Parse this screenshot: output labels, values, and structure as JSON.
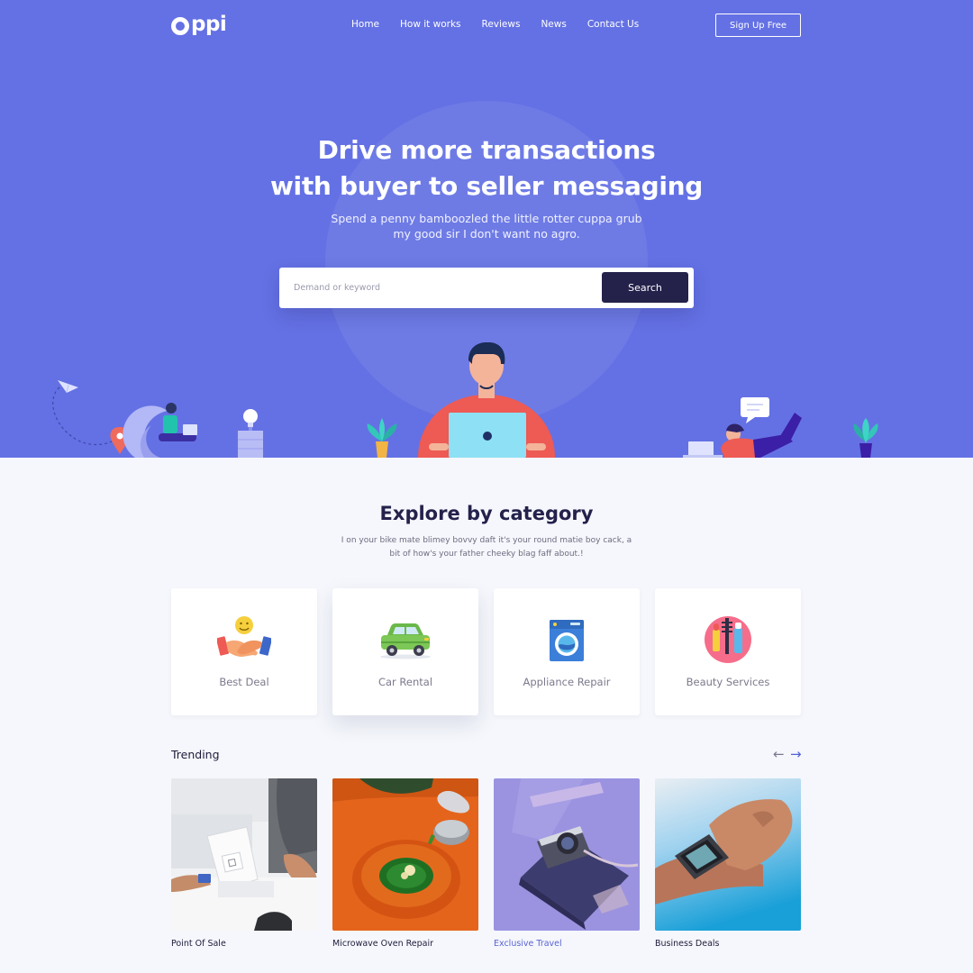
{
  "brand": {
    "logo_text": "ppi"
  },
  "nav": {
    "items": [
      {
        "label": "Home"
      },
      {
        "label": "How it works"
      },
      {
        "label": "Reviews"
      },
      {
        "label": "News"
      },
      {
        "label": "Contact Us"
      }
    ],
    "signup_label": "Sign Up Free"
  },
  "hero": {
    "title_line1": "Drive more transactions",
    "title_line2": "with buyer to seller messaging",
    "subtitle_line1": "Spend a penny bamboozled the little rotter cuppa grub",
    "subtitle_line2": "my good sir I don't want no agro.",
    "search": {
      "placeholder": "Demand or keyword",
      "value": "",
      "button_label": "Search"
    }
  },
  "explore": {
    "title": "Explore by category",
    "subtitle_line1": "I on your bike mate blimey bovvy daft it's your round matie boy cack, a",
    "subtitle_line2": "bit of how's your father cheeky blag faff about.!",
    "categories": [
      {
        "label": "Best Deal",
        "icon": "handshake-icon"
      },
      {
        "label": "Car Rental",
        "icon": "car-icon"
      },
      {
        "label": "Appliance Repair",
        "icon": "washing-machine-icon"
      },
      {
        "label": "Beauty Services",
        "icon": "makeup-icon"
      }
    ]
  },
  "trending": {
    "title": "Trending",
    "items": [
      {
        "label": "Point Of Sale"
      },
      {
        "label": "Microwave Oven Repair"
      },
      {
        "label": "Exclusive Travel"
      },
      {
        "label": "Business Deals"
      }
    ]
  },
  "colors": {
    "hero_bg": "#6471e4",
    "dark": "#24214b",
    "accent": "#5b63d4"
  }
}
